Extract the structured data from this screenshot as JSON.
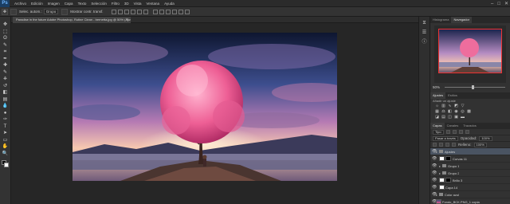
{
  "app": {
    "logo": "Ps",
    "menu": [
      "Archivo",
      "Edición",
      "Imagen",
      "Capa",
      "Texto",
      "Selección",
      "Filtro",
      "3D",
      "Vista",
      "Ventana",
      "Ayuda"
    ],
    "window_controls": [
      "–",
      "□",
      "✕"
    ]
  },
  "options_bar": {
    "auto_select_label": "Selec. autom.:",
    "auto_select_value": "Grupo",
    "transform_label": "Mostrar contr. transf."
  },
  "document": {
    "tab_title": "Paradise in the future Adobe Photoshop, Rutine Clean - bernetta.jpg @ 50% (Ajustes, RGB/8*)",
    "tab_close": "×"
  },
  "tools": [
    "move-icon",
    "marquee-icon",
    "lasso-icon",
    "quick-select-icon",
    "crop-icon",
    "eyedropper-icon",
    "healing-icon",
    "brush-icon",
    "stamp-icon",
    "history-brush-icon",
    "eraser-icon",
    "gradient-icon",
    "blur-icon",
    "dodge-icon",
    "pen-icon",
    "type-icon",
    "path-select-icon",
    "shape-icon",
    "hand-icon",
    "zoom-icon"
  ],
  "tool_glyphs": [
    "✥",
    "⬚",
    "ʘ",
    "✎",
    "⌗",
    "✒",
    "✚",
    "✎",
    "⎈",
    "↺",
    "◧",
    "▤",
    "💧",
    "●",
    "✑",
    "T",
    "➤",
    "▭",
    "✋",
    "🔍"
  ],
  "panels": {
    "nav_tabs": [
      "Histograma",
      "Navegador"
    ],
    "nav_active": 1,
    "zoom": "50%",
    "adjust_tabs": [
      "Ajustes",
      "Estilos"
    ],
    "adjust_subtitle": "Añadir un ajuste",
    "layers_tabs": [
      "Capas",
      "Canales",
      "Trazados"
    ],
    "layers_active": 0,
    "kind_filter": "Tipo",
    "blend_mode": "Pasar a través",
    "opacity_label": "Opacidad:",
    "opacity": "100%",
    "fill_label": "Relleno:",
    "fill": "100%",
    "layers": [
      {
        "name": "Ajustes",
        "type": "group",
        "selected": true,
        "indent": 0,
        "thumb": "none"
      },
      {
        "name": "Curvas 11",
        "type": "adjust",
        "selected": false,
        "indent": 1,
        "thumb": "white"
      },
      {
        "name": "Grupo 1",
        "type": "group",
        "selected": false,
        "indent": 1,
        "thumb": "none"
      },
      {
        "name": "Grupo 2",
        "type": "group",
        "selected": false,
        "indent": 1,
        "thumb": "none"
      },
      {
        "name": "Brillo 3",
        "type": "adjust",
        "selected": false,
        "indent": 1,
        "thumb": "white"
      },
      {
        "name": "Capa 14",
        "type": "layer",
        "selected": false,
        "indent": 1,
        "thumb": "white"
      },
      {
        "name": "Color azul",
        "type": "group",
        "selected": false,
        "indent": 0,
        "thumb": "none"
      },
      {
        "name": "Fondo_BCK.PNG_1 copia",
        "type": "layer",
        "selected": false,
        "indent": 0,
        "thumb": "img"
      }
    ]
  }
}
